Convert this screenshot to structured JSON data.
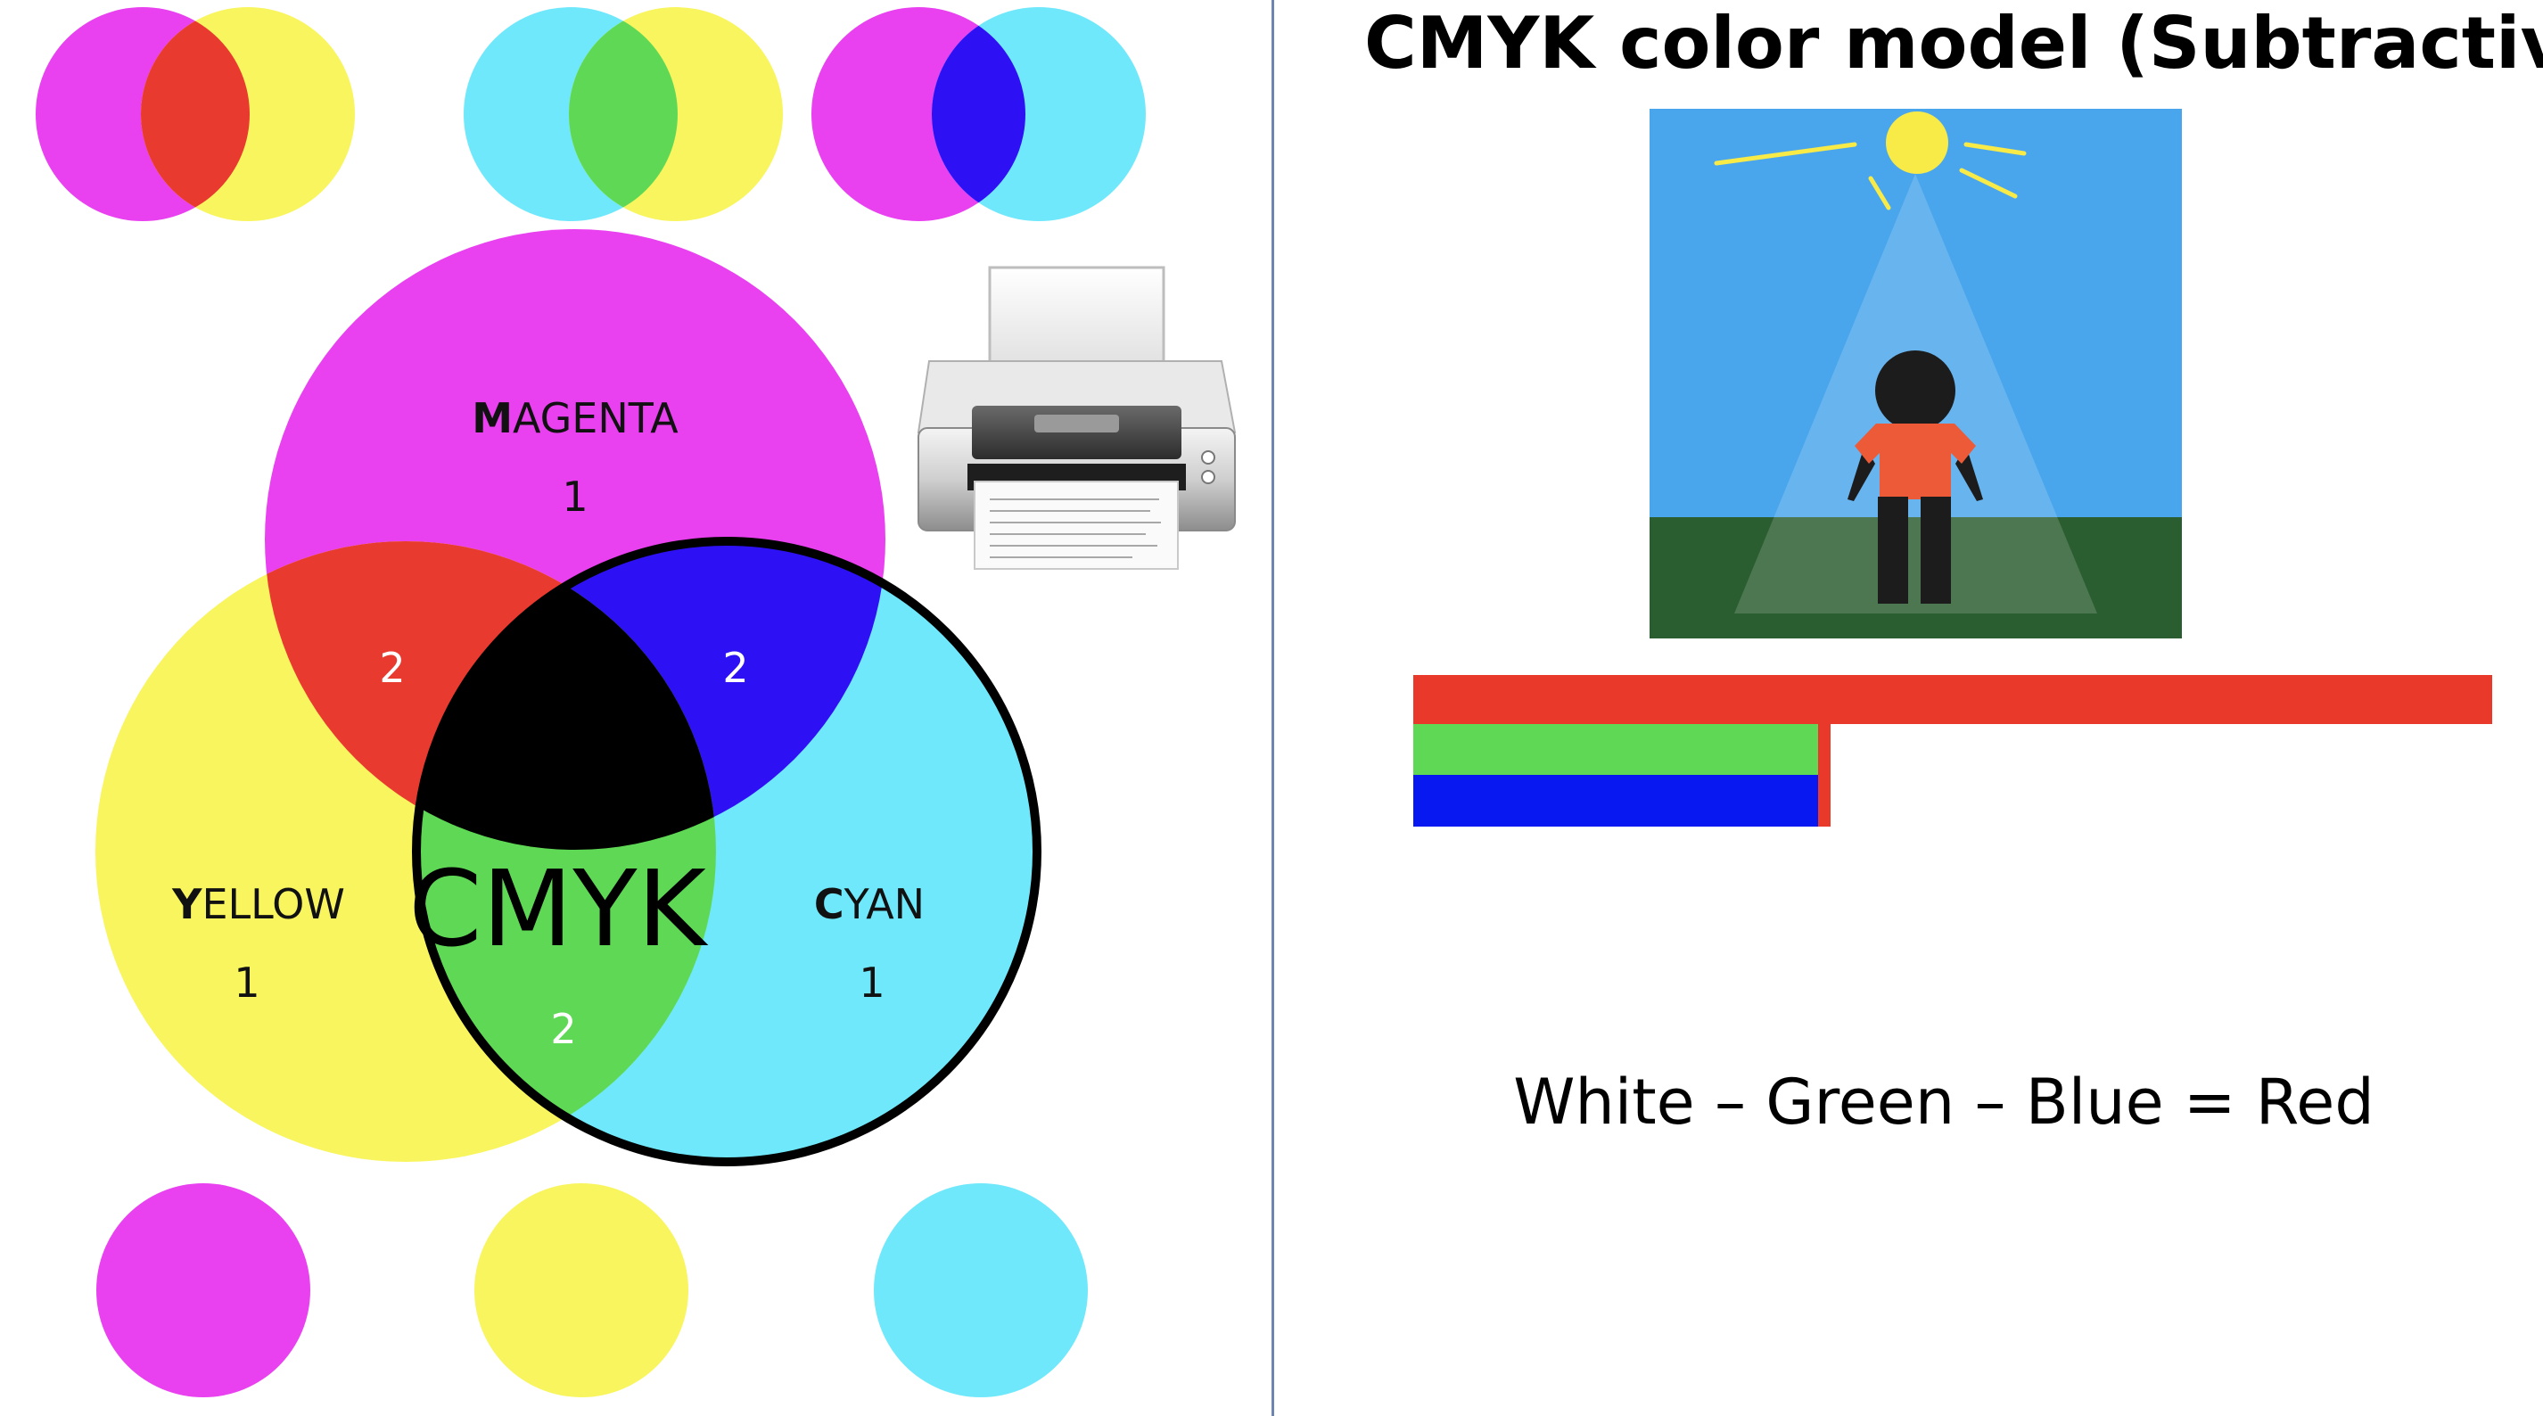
{
  "slide": {
    "title": "CMYK color model (Subtractive)",
    "equation": "White – Green – Blue = Red"
  },
  "venn": {
    "labels": {
      "magenta": {
        "first": "M",
        "rest": "AGENTA",
        "count": "1"
      },
      "yellow": {
        "first": "Y",
        "rest": "ELLOW",
        "count": "1"
      },
      "cyan": {
        "first": "C",
        "rest": "YAN",
        "count": "1"
      }
    },
    "overlap_counts": {
      "red": "2",
      "blue": "2",
      "green": "2"
    },
    "center_label": "CMYK"
  },
  "colors": {
    "magenta": "#e940f0",
    "yellow": "#f8f55e",
    "cyan": "#70e8fb",
    "red": "#e83a2f",
    "green": "#5fd955",
    "blue": "#2e10f5",
    "black": "#000000",
    "sky": "#4aa6ec",
    "grass": "#2a5e30",
    "sun": "#f8ea47",
    "shirt": "#ec5a38",
    "bar_red": "#e8392a",
    "bar_green": "#5fd955",
    "bar_blue": "#0818f0",
    "divider": "#6c86b0"
  },
  "icons": [
    "printer-icon",
    "person-in-sunlight-illustration"
  ],
  "bars": {
    "red_fraction": 1.0,
    "green_fraction": 0.375,
    "blue_fraction": 0.375
  }
}
